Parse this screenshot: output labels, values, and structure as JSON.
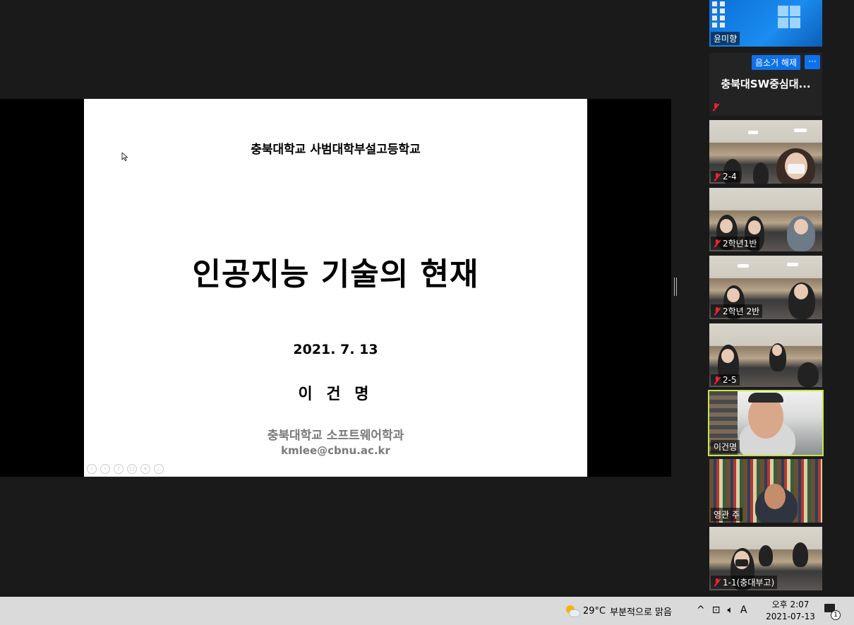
{
  "slide": {
    "school": "충북대학교 사범대학부설고등학교",
    "title": "인공지능 기술의 현재",
    "date": "2021. 7. 13",
    "author": "이 건 명",
    "department": "충북대학교 소프트웨어학과",
    "email": "kmlee@cbnu.ac.kr"
  },
  "gallery": {
    "tiles": [
      {
        "name": "윤미향"
      },
      {
        "name": "충북대SW중심대...",
        "unmute_label": "음소거 해제",
        "more_label": "···"
      },
      {
        "name": "2-4"
      },
      {
        "name": "2학년1반"
      },
      {
        "name": "2학년 2반"
      },
      {
        "name": "2-5"
      },
      {
        "name": "이건명"
      },
      {
        "name": "영관 주"
      },
      {
        "name": "1-1(충대부고)"
      }
    ]
  },
  "taskbar": {
    "temperature": "29°C",
    "weather": "부분적으로 맑음",
    "ime": "A",
    "time": "오후 2:07",
    "date": "2021-07-13",
    "notification_count": "1"
  }
}
